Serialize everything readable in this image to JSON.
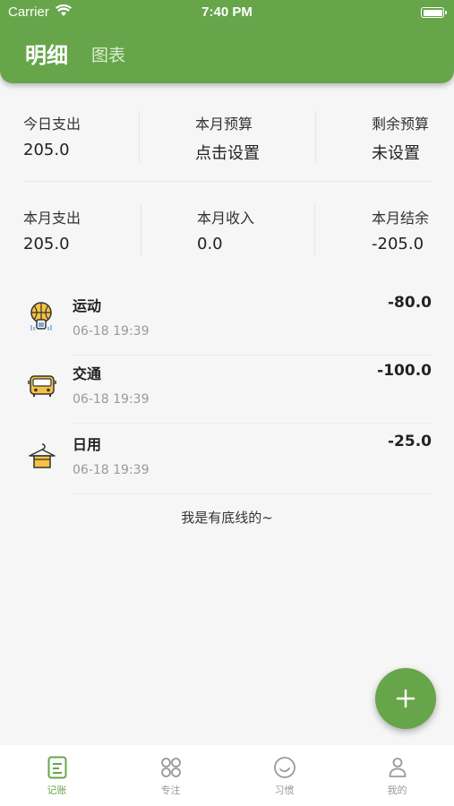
{
  "status_bar": {
    "carrier": "Carrier",
    "time": "7:40 PM"
  },
  "header": {
    "tabs": [
      {
        "label": "明细",
        "active": true
      },
      {
        "label": "图表",
        "active": false
      }
    ],
    "color": "#67a54b"
  },
  "stats": {
    "row1": [
      {
        "label": "今日支出",
        "value": "205.0"
      },
      {
        "label": "本月预算",
        "value": "点击设置"
      },
      {
        "label": "剩余预算",
        "value": "未设置"
      }
    ],
    "row2": [
      {
        "label": "本月支出",
        "value": "205.0"
      },
      {
        "label": "本月收入",
        "value": "0.0"
      },
      {
        "label": "本月结余",
        "value": "-205.0"
      }
    ]
  },
  "records": [
    {
      "category": "运动",
      "time": "06-18  19:39",
      "amount": "-80.0",
      "icon": "sports-basketball-icon"
    },
    {
      "category": "交通",
      "time": "06-18  19:39",
      "amount": "-100.0",
      "icon": "bus-icon"
    },
    {
      "category": "日用",
      "time": "06-18  19:39",
      "amount": "-25.0",
      "icon": "hanger-icon"
    }
  ],
  "footer_note": "我是有底线的~",
  "bottom_nav": [
    {
      "label": "记账",
      "icon": "ledger-icon",
      "active": true
    },
    {
      "label": "专注",
      "icon": "grid-icon",
      "active": false
    },
    {
      "label": "习惯",
      "icon": "smile-icon",
      "active": false
    },
    {
      "label": "我的",
      "icon": "person-icon",
      "active": false
    }
  ]
}
